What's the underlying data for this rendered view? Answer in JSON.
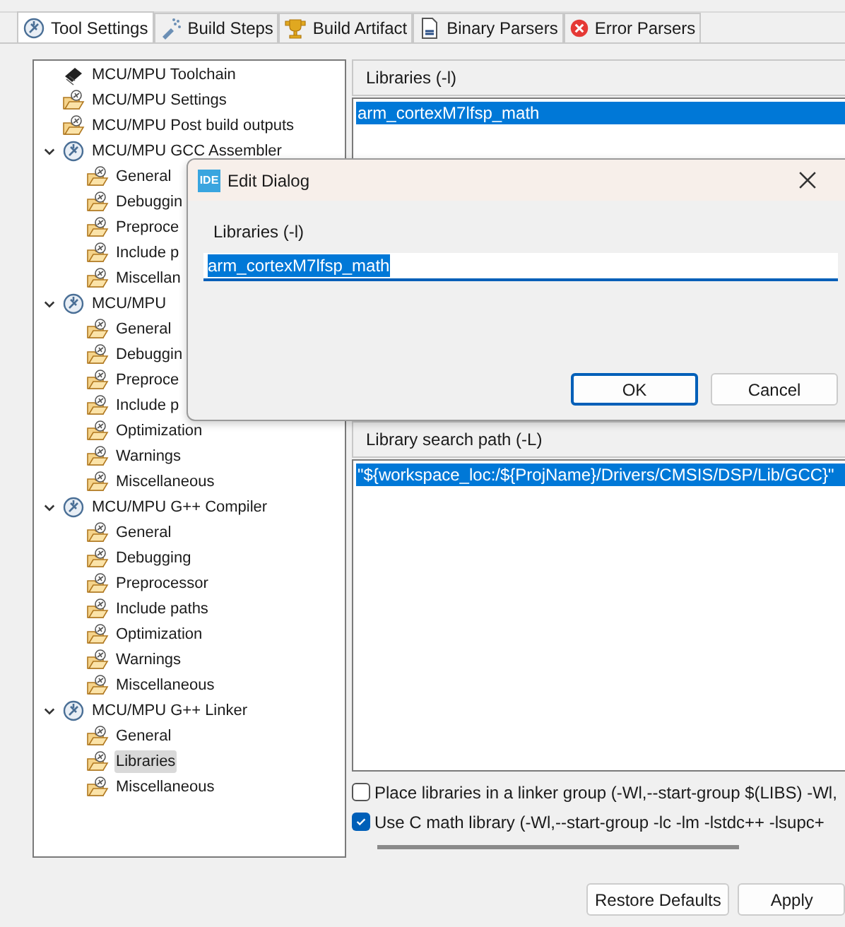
{
  "tabs": [
    {
      "label": "Tool Settings",
      "kind": "gear",
      "selected": true
    },
    {
      "label": "Build Steps",
      "kind": "steps",
      "selected": false
    },
    {
      "label": "Build Artifact",
      "kind": "trophy",
      "selected": false
    },
    {
      "label": "Binary Parsers",
      "kind": "binary",
      "selected": false
    },
    {
      "label": "Error Parsers",
      "kind": "error",
      "selected": false
    }
  ],
  "tree": [
    {
      "label": "MCU/MPU Toolchain",
      "kind": "chip",
      "selected": false
    },
    {
      "label": "MCU/MPU Settings",
      "kind": "folder",
      "selected": false
    },
    {
      "label": "MCU/MPU Post build outputs",
      "kind": "folder",
      "selected": false
    },
    {
      "label": "MCU/MPU GCC Assembler",
      "kind": "tool",
      "expanded": true,
      "selected": false,
      "children": [
        {
          "label": "General",
          "kind": "folder",
          "selected": false
        },
        {
          "label": "Debuggin",
          "kind": "folder",
          "selected": false
        },
        {
          "label": "Preproce",
          "kind": "folder",
          "selected": false
        },
        {
          "label": "Include p",
          "kind": "folder",
          "selected": false
        },
        {
          "label": "Miscellan",
          "kind": "folder",
          "selected": false
        }
      ]
    },
    {
      "label": "MCU/MPU",
      "kind": "tool",
      "expanded": true,
      "selected": false,
      "children": [
        {
          "label": "General",
          "kind": "folder",
          "selected": false
        },
        {
          "label": "Debuggin",
          "kind": "folder",
          "selected": false
        },
        {
          "label": "Preproce",
          "kind": "folder",
          "selected": false
        },
        {
          "label": "Include p",
          "kind": "folder",
          "selected": false
        },
        {
          "label": "Optimization",
          "kind": "folder",
          "selected": false
        },
        {
          "label": "Warnings",
          "kind": "folder",
          "selected": false
        },
        {
          "label": "Miscellaneous",
          "kind": "folder",
          "selected": false
        }
      ]
    },
    {
      "label": "MCU/MPU G++ Compiler",
      "kind": "tool",
      "expanded": true,
      "selected": false,
      "children": [
        {
          "label": "General",
          "kind": "folder",
          "selected": false
        },
        {
          "label": "Debugging",
          "kind": "folder",
          "selected": false
        },
        {
          "label": "Preprocessor",
          "kind": "folder",
          "selected": false
        },
        {
          "label": "Include paths",
          "kind": "folder",
          "selected": false
        },
        {
          "label": "Optimization",
          "kind": "folder",
          "selected": false
        },
        {
          "label": "Warnings",
          "kind": "folder",
          "selected": false
        },
        {
          "label": "Miscellaneous",
          "kind": "folder",
          "selected": false
        }
      ]
    },
    {
      "label": "MCU/MPU G++ Linker",
      "kind": "tool",
      "expanded": true,
      "selected": false,
      "children": [
        {
          "label": "General",
          "kind": "folder",
          "selected": false
        },
        {
          "label": "Libraries",
          "kind": "folder",
          "selected": true
        },
        {
          "label": "Miscellaneous",
          "kind": "folder",
          "selected": false
        }
      ]
    }
  ],
  "libraries": {
    "title": "Libraries (-l)",
    "items": [
      {
        "label": "arm_cortexM7lfsp_math",
        "selected": true
      }
    ]
  },
  "library_search_path": {
    "title": "Library search path (-L)",
    "items": [
      {
        "label": "\"${workspace_loc:/${ProjName}/Drivers/CMSIS/DSP/Lib/GCC}\"",
        "selected": true
      }
    ]
  },
  "options": [
    {
      "label": "Place libraries in a linker group (-Wl,--start-group $(LIBS) -Wl,",
      "checked": false
    },
    {
      "label": "Use C math library (-Wl,--start-group -lc -lm -lstdc++ -lsupc+",
      "checked": true
    }
  ],
  "buttons": [
    "Restore Defaults",
    "Apply"
  ],
  "dialog": {
    "title": "Edit Dialog",
    "logo": "IDE",
    "field_label": "Libraries (-l)",
    "value": "arm_cortexM7lfsp_math",
    "buttons": [
      {
        "label": "OK",
        "default": true
      },
      {
        "label": "Cancel",
        "default": false
      }
    ]
  }
}
